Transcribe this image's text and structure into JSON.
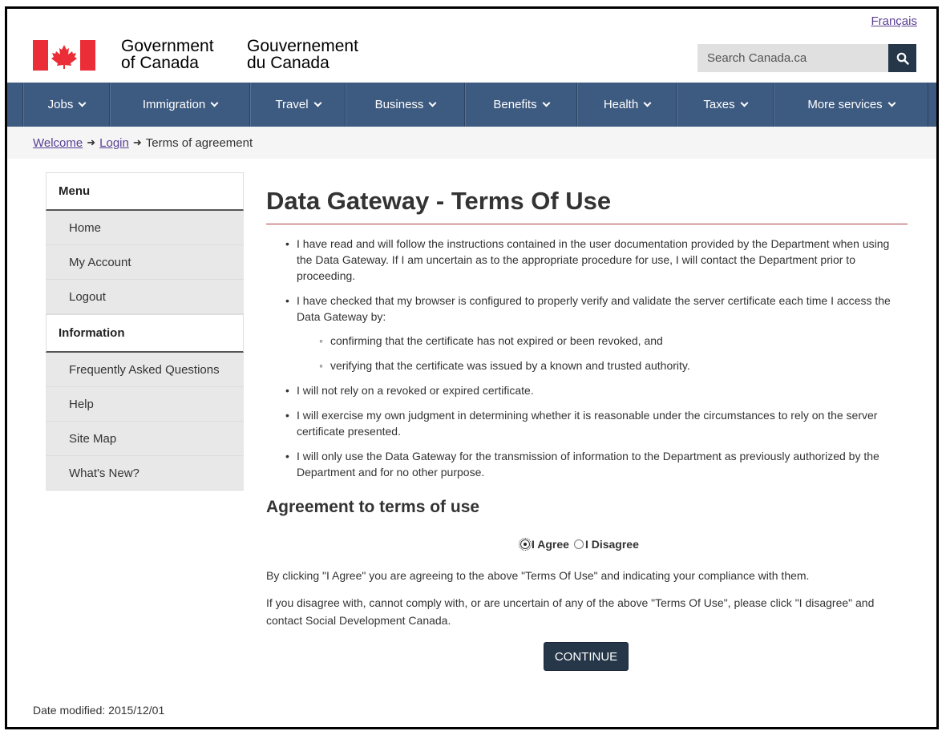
{
  "header": {
    "language_link": "Français",
    "gov_en_line1": "Government",
    "gov_en_line2": "of Canada",
    "gov_fr_line1": "Gouvernement",
    "gov_fr_line2": "du Canada",
    "search_placeholder": "Search Canada.ca",
    "search_icon": "search-icon",
    "flag_red": "#eb2d37"
  },
  "nav": {
    "items": [
      {
        "label": "Jobs"
      },
      {
        "label": "Immigration"
      },
      {
        "label": "Travel"
      },
      {
        "label": "Business"
      },
      {
        "label": "Benefits"
      },
      {
        "label": "Health"
      },
      {
        "label": "Taxes"
      },
      {
        "label": "More services"
      }
    ]
  },
  "breadcrumb": {
    "items": [
      "Welcome",
      "Login"
    ],
    "current": "Terms of agreement"
  },
  "sidebar": {
    "menu_heading": "Menu",
    "menu_items": [
      "Home",
      "My Account",
      "Logout"
    ],
    "info_heading": "Information",
    "info_items": [
      "Frequently Asked Questions",
      "Help",
      "Site Map",
      "What's New?"
    ]
  },
  "main": {
    "title": "Data Gateway - Terms Of Use",
    "terms": [
      "I have read and will follow the instructions contained in the user documentation provided by the Department when using the Data Gateway. If I am uncertain as to the appropriate procedure for use, I will contact the Department prior to proceeding.",
      "I have checked that my browser is configured to properly verify and validate the server certificate each time I access the Data Gateway by:",
      "I will not rely on a revoked or expired certificate.",
      "I will exercise my own judgment in determining whether it is reasonable under the circumstances to rely on the server certificate presented.",
      "I will only use the Data Gateway for the transmission of information to the Department as previously authorized by the Department and for no other purpose."
    ],
    "sub_terms": [
      "confirming that the certificate has not expired or been revoked, and",
      "verifying that the certificate was issued by a known and trusted authority."
    ],
    "agreement_heading": "Agreement to terms of use",
    "agree_label": "I Agree",
    "disagree_label": "I Disagree",
    "selected": "I Agree",
    "para_agree": "By clicking \"I Agree\" you are agreeing to the above \"Terms Of Use\" and indicating your compliance with them.",
    "para_disagree": "If you disagree with, cannot comply with, or are uncertain of any of the above \"Terms Of Use\", please click \"I disagree\" and contact Social Development Canada.",
    "continue_label": "CONTINUE"
  },
  "footer": {
    "date_modified": "Date modified: 2015/12/01"
  }
}
